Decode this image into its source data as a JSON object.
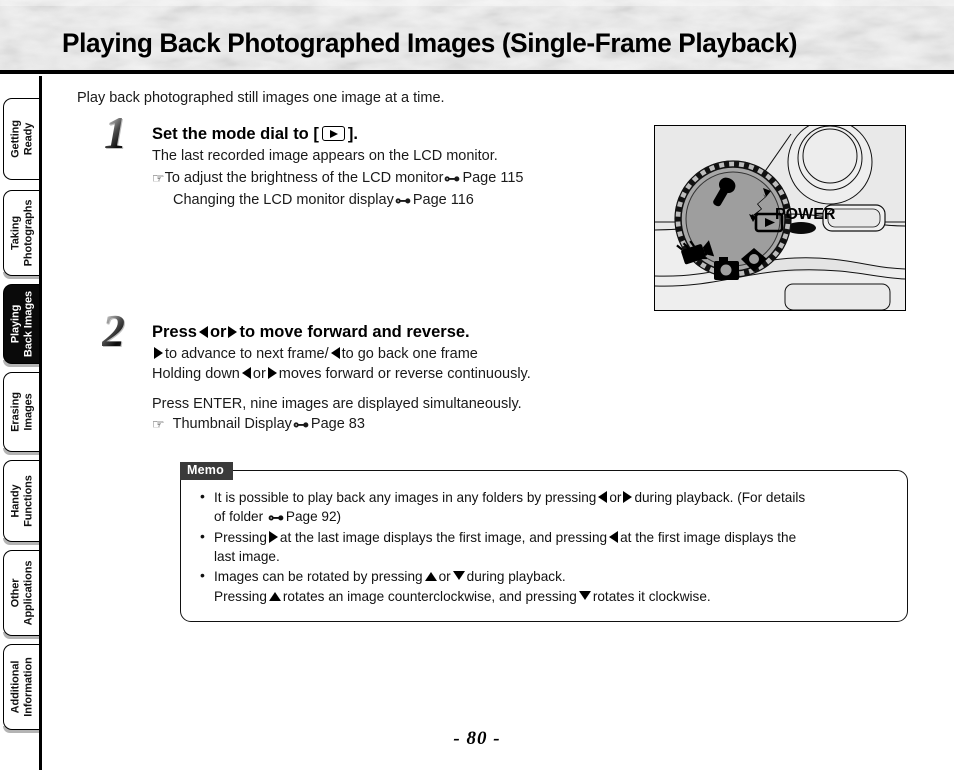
{
  "page": {
    "title": "Playing Back Photographed Images (Single-Frame Playback)",
    "number": "- 80 -",
    "intro": "Play back photographed still images one image at a time."
  },
  "sidebar": {
    "items": [
      {
        "label_line1": "Getting",
        "label_line2": "Ready",
        "active": false
      },
      {
        "label_line1": "Taking",
        "label_line2": "Photographs",
        "active": false
      },
      {
        "label_line1": "Playing",
        "label_line2": "Back Images",
        "active": true
      },
      {
        "label_line1": "Erasing",
        "label_line2": "Images",
        "active": false
      },
      {
        "label_line1": "Handy",
        "label_line2": "Functions",
        "active": false
      },
      {
        "label_line1": "Other",
        "label_line2": "Applications",
        "active": false
      },
      {
        "label_line1": "Additional",
        "label_line2": "Information",
        "active": false
      }
    ]
  },
  "steps": [
    {
      "number": "1",
      "heading_before": "Set the mode dial to [",
      "heading_icon": "playback-icon",
      "heading_after": "].",
      "line1": "The last recorded image appears on the LCD monitor.",
      "ref1_icon": "pointing-hand-icon",
      "ref1_text": "To adjust the brightness of the LCD monitor",
      "ref1_page": "Page 115",
      "ref2_text": "Changing the LCD monitor display",
      "ref2_page": "Page 116"
    },
    {
      "number": "2",
      "heading_part1": "Press",
      "heading_icon1": "triangle-left-icon",
      "heading_part2": "or",
      "heading_icon2": "triangle-right-icon",
      "heading_part3": "to move forward and reverse.",
      "line1_a": "to advance to next frame/",
      "line1_b": "to go back one frame",
      "line2_a": "Holding down",
      "line2_b": "or",
      "line2_c": "moves forward or reverse continuously.",
      "line3": "Press ENTER, nine images are displayed simultaneously.",
      "ref_icon": "pointing-hand-icon",
      "ref_text": "Thumbnail Display",
      "ref_page": "Page 83"
    }
  ],
  "memo": {
    "label": "Memo",
    "items": [
      {
        "a": "It is possible to play back any images in any folders by pressing",
        "b": "or",
        "c": "during playback. (For details",
        "cont_a": "of folder",
        "cont_page": "Page 92)"
      },
      {
        "a": "Pressing",
        "b": "at the last image displays the first image, and pressing",
        "c": "at the first image displays the",
        "cont_a": "last image."
      },
      {
        "a": "Images can be rotated by pressing",
        "b": "or",
        "c": "during playback."
      },
      {
        "nobullet": true,
        "a": "Pressing",
        "b": "rotates an image counterclockwise, and pressing",
        "c": "rotates it clockwise."
      }
    ]
  },
  "figure": {
    "name": "camera-mode-dial-illustration",
    "power_label": "POWER",
    "dial_marks": [
      "setup-wrench-icon",
      "transfer-arrow-icon",
      "playback-icon",
      "scene-diamond-icon",
      "manual-camera-icon",
      "movie-camera-icon"
    ]
  },
  "colors": {
    "accent": "#000000",
    "memo_label_bg": "#3a3a3a",
    "figure_bg": "#e9e9e9",
    "dial_face": "#9e9e9e"
  }
}
